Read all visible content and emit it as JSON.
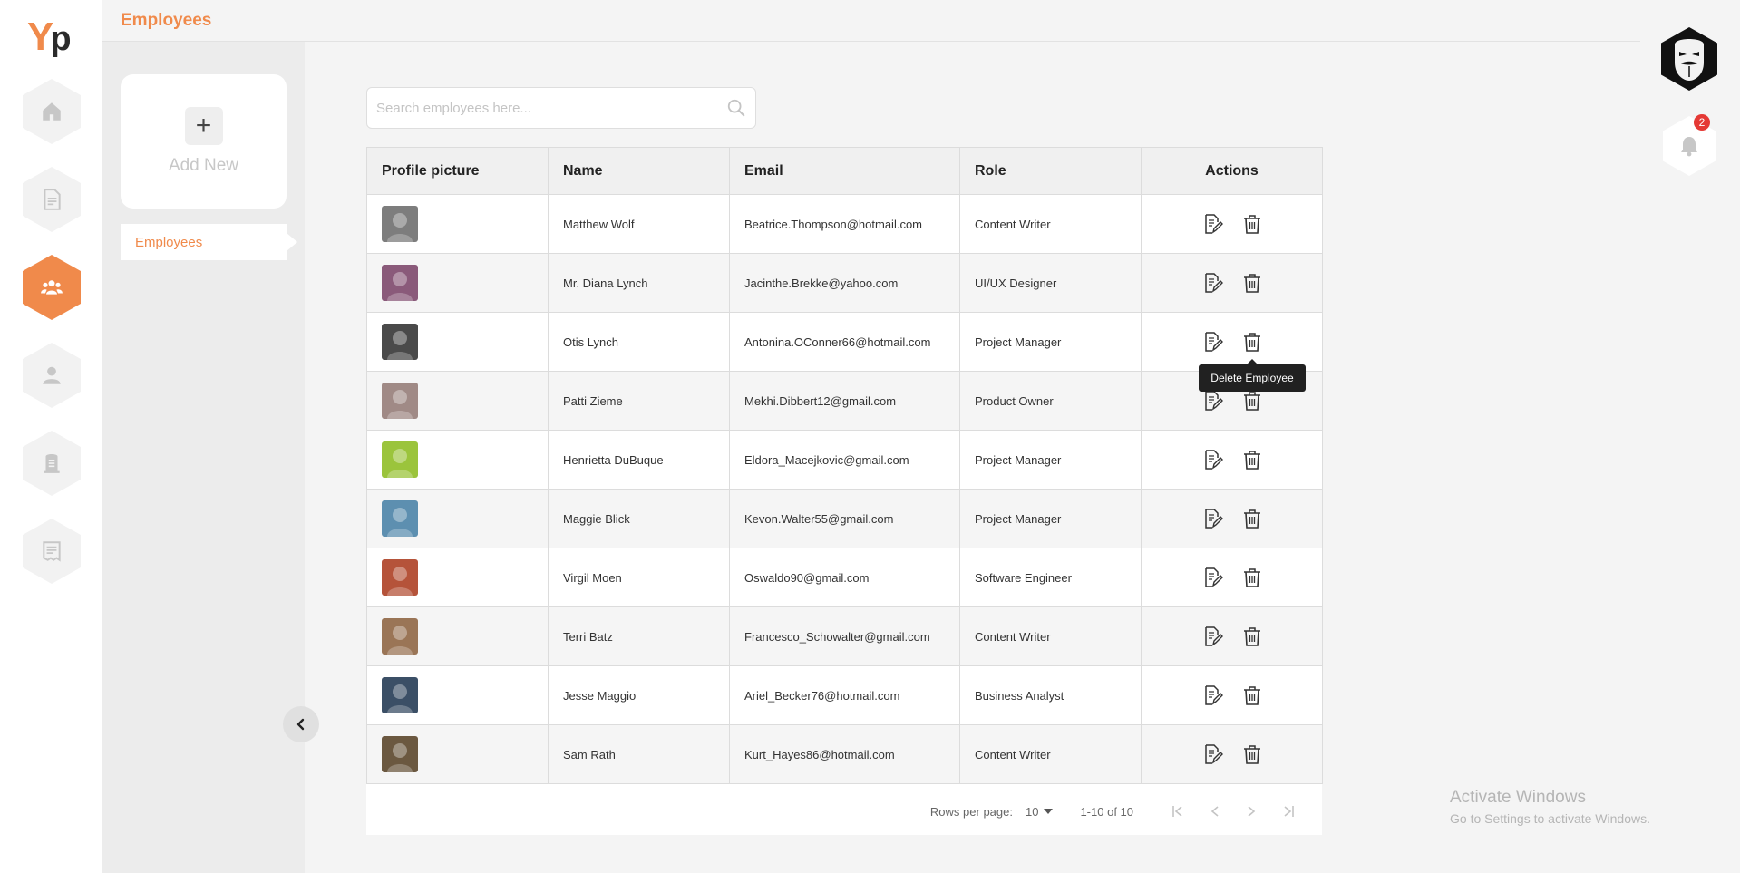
{
  "app": {
    "logo_y": "Y",
    "logo_p": "p",
    "brand_color": "#f08a4b"
  },
  "header": {
    "title": "Employees"
  },
  "rail": {
    "items": [
      {
        "icon": "home-icon",
        "active": false
      },
      {
        "icon": "document-icon",
        "active": false
      },
      {
        "icon": "users-icon",
        "active": true
      },
      {
        "icon": "user-icon",
        "active": false
      },
      {
        "icon": "badge-icon",
        "active": false
      },
      {
        "icon": "receipt-icon",
        "active": false
      }
    ]
  },
  "subbar": {
    "add_new_label": "Add New",
    "add_plus": "+",
    "active_item": "Employees"
  },
  "search": {
    "placeholder": "Search employees here..."
  },
  "table": {
    "columns": [
      "Profile picture",
      "Name",
      "Email",
      "Role",
      "Actions"
    ],
    "rows": [
      {
        "name": "Matthew Wolf",
        "email": "Beatrice.Thompson@hotmail.com",
        "role": "Content Writer",
        "color": "#7d7d7d"
      },
      {
        "name": "Mr. Diana Lynch",
        "email": "Jacinthe.Brekke@yahoo.com",
        "role": "UI/UX Designer",
        "color": "#8a5a7a"
      },
      {
        "name": "Otis Lynch",
        "email": "Antonina.OConner66@hotmail.com",
        "role": "Project Manager",
        "color": "#4a4a4a"
      },
      {
        "name": "Patti Zieme",
        "email": "Mekhi.Dibbert12@gmail.com",
        "role": "Product Owner",
        "color": "#a08a86"
      },
      {
        "name": "Henrietta DuBuque",
        "email": "Eldora_Macejkovic@gmail.com",
        "role": "Project Manager",
        "color": "#9bc43c"
      },
      {
        "name": "Maggie Blick",
        "email": "Kevon.Walter55@gmail.com",
        "role": "Project Manager",
        "color": "#5d8fb0"
      },
      {
        "name": "Virgil Moen",
        "email": "Oswaldo90@gmail.com",
        "role": "Software Engineer",
        "color": "#b5533a"
      },
      {
        "name": "Terri Batz",
        "email": "Francesco_Schowalter@gmail.com",
        "role": "Content Writer",
        "color": "#9a7556"
      },
      {
        "name": "Jesse Maggio",
        "email": "Ariel_Becker76@hotmail.com",
        "role": "Business Analyst",
        "color": "#3b4f66"
      },
      {
        "name": "Sam Rath",
        "email": "Kurt_Hayes86@hotmail.com",
        "role": "Content Writer",
        "color": "#6b5840"
      }
    ]
  },
  "tooltip": {
    "text": "Delete Employee"
  },
  "pagination": {
    "rows_per_page_label": "Rows per page:",
    "rows_per_page_value": "10",
    "range": "1-10 of 10"
  },
  "notifications": {
    "count": "2"
  },
  "watermark": {
    "line1": "Activate Windows",
    "line2": "Go to Settings to activate Windows."
  }
}
